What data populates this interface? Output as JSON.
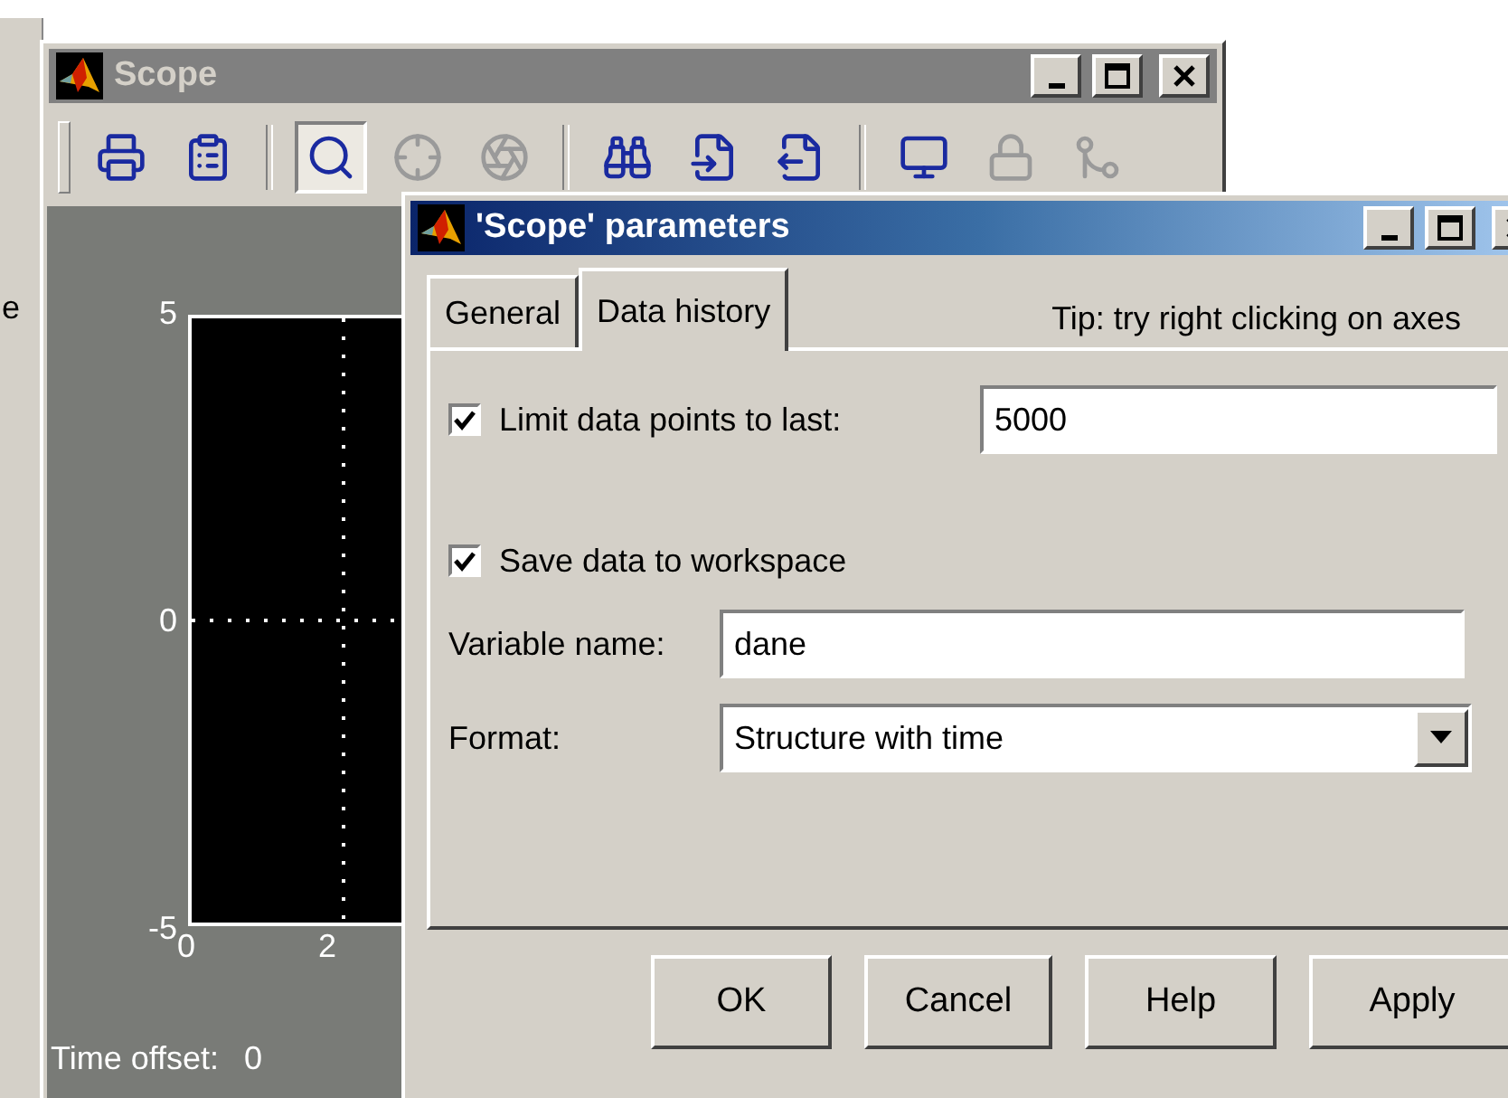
{
  "back_window": {
    "text_fragment": "e"
  },
  "scope_window": {
    "title": "Scope",
    "active": false,
    "toolbar": [
      {
        "kind": "print",
        "pressed": false,
        "disabled": false
      },
      {
        "kind": "parameters",
        "pressed": false,
        "disabled": false
      },
      {
        "kind": "separator"
      },
      {
        "kind": "zoom",
        "pressed": true,
        "disabled": false
      },
      {
        "kind": "zoom-x",
        "pressed": false,
        "disabled": true
      },
      {
        "kind": "zoom-y",
        "pressed": false,
        "disabled": true
      },
      {
        "kind": "separator"
      },
      {
        "kind": "autoscale",
        "pressed": false,
        "disabled": false
      },
      {
        "kind": "save-axes",
        "pressed": false,
        "disabled": false
      },
      {
        "kind": "restore-axes",
        "pressed": false,
        "disabled": false
      },
      {
        "kind": "separator"
      },
      {
        "kind": "floating",
        "pressed": false,
        "disabled": false
      },
      {
        "kind": "lock",
        "pressed": false,
        "disabled": true
      },
      {
        "kind": "signal-selection",
        "pressed": false,
        "disabled": true
      }
    ],
    "y_ticks": [
      "5",
      "0",
      "-5"
    ],
    "x_ticks": [
      "0",
      "2"
    ],
    "time_offset_label": "Time offset:",
    "time_offset_value": "0"
  },
  "dialog": {
    "title": "'Scope' parameters",
    "active": true,
    "tabs": [
      {
        "label": "General",
        "selected": false
      },
      {
        "label": "Data history",
        "selected": true
      }
    ],
    "tip": "Tip:  try right clicking on axes",
    "limit_points": {
      "label": "Limit data points to last:",
      "checked": true,
      "value": "5000"
    },
    "save_to_workspace": {
      "label": "Save data to workspace",
      "checked": true
    },
    "variable_name": {
      "label": "Variable name:",
      "value": "dane"
    },
    "format": {
      "label": "Format:",
      "value": "Structure with time"
    },
    "buttons": [
      "OK",
      "Cancel",
      "Help",
      "Apply"
    ]
  }
}
